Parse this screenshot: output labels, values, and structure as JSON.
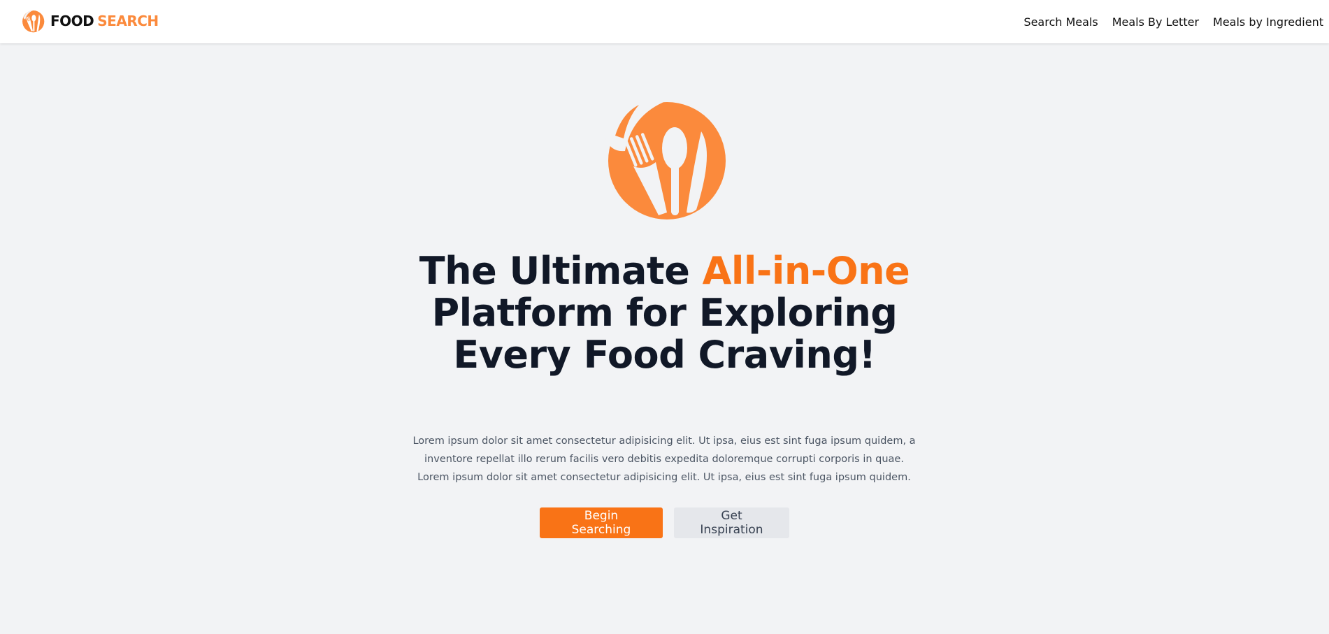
{
  "brand": {
    "word1": "FOOD",
    "word2": "SEARCH",
    "icon": "utensils-plate-icon"
  },
  "nav": {
    "items": [
      "Search Meals",
      "Meals By Letter",
      "Meals by Ingredient"
    ]
  },
  "hero": {
    "icon": "utensils-plate-icon",
    "headline_part1": "The Ultimate ",
    "headline_accent": "All-in-One",
    "headline_line2": "Platform for Exploring",
    "headline_line3": "Every Food Craving!",
    "description": "Lorem ipsum dolor sit amet consectetur adipisicing elit. Ut ipsa, eius est sint fuga ipsum quidem, a inventore repellat illo rerum facilis vero debitis expedita doloremque corrupti corporis in quae. Lorem ipsum dolor sit amet consectetur adipisicing elit. Ut ipsa, eius est sint fuga ipsum quidem.",
    "primary_button": "Begin Searching",
    "secondary_button": "Get Inspiration"
  },
  "colors": {
    "accent": "#f97316",
    "logo_orange": "#fb8a3c",
    "background": "#f2f3f5",
    "headline": "#111827",
    "secondary_button_bg": "#e5e7eb"
  }
}
